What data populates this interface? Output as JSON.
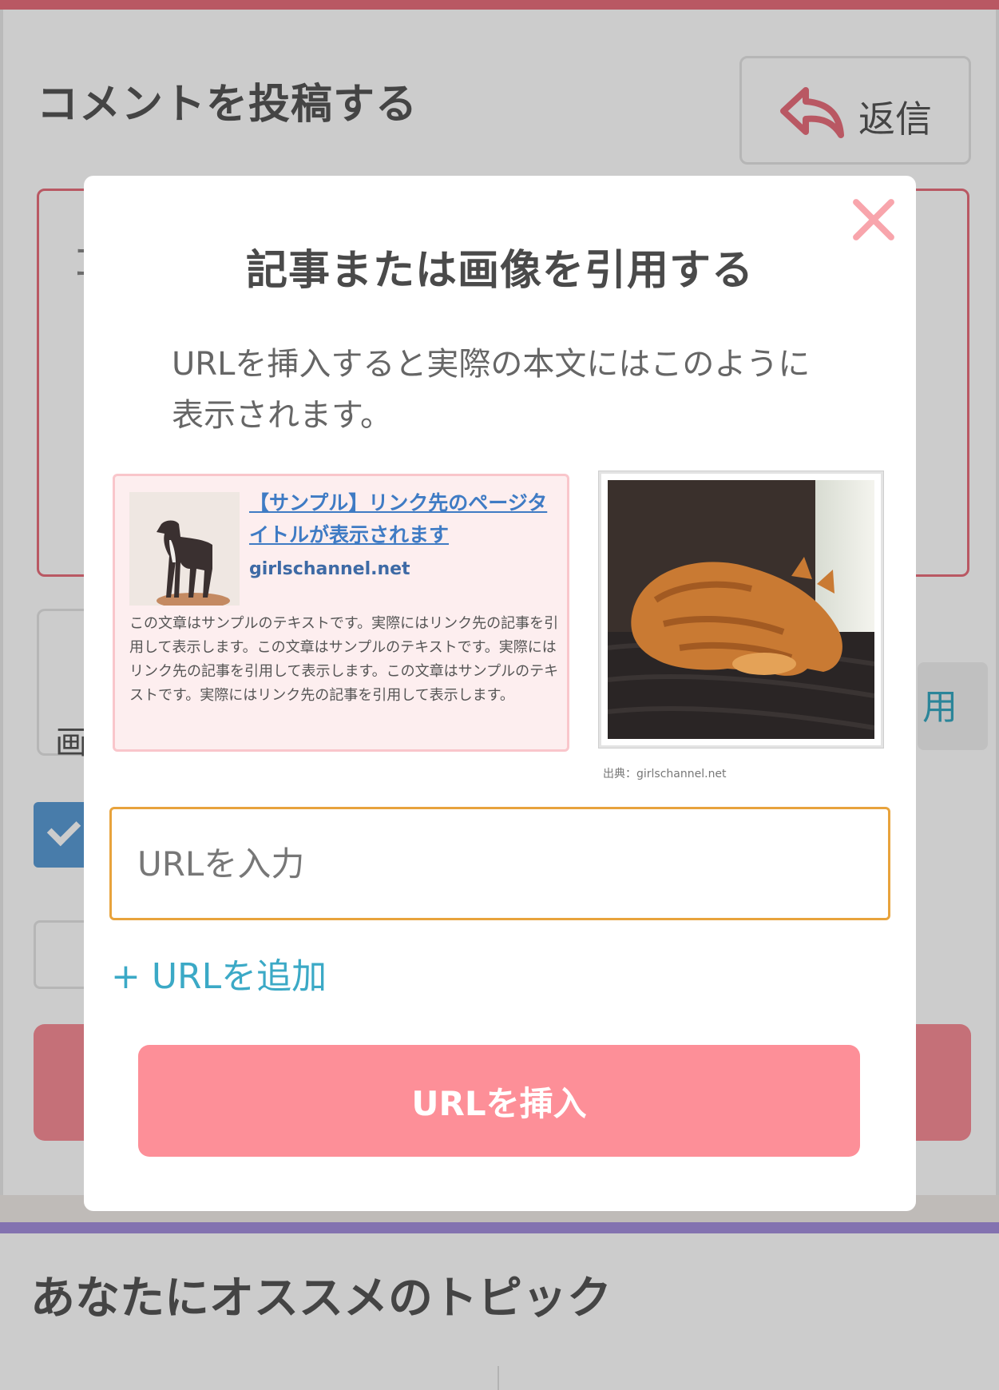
{
  "background": {
    "title": "コメントを投稿する",
    "reply_label": "返信",
    "textarea_char": "コ",
    "quote_chip_char": "用",
    "image_label": "画",
    "recommend_title": "あなたにオススメのトピック"
  },
  "modal": {
    "title": "記事または画像を引用する",
    "description": "URLを挿入すると実際の本文にはこのように表示されます。",
    "sample_link": {
      "title": "【サンプル】リンク先のページタイトルが表示されます",
      "domain": "girlschannel.net",
      "body": "この文章はサンプルのテキストです。実際にはリンク先の記事を引用して表示します。この文章はサンプルのテキストです。実際にはリンク先の記事を引用して表示します。この文章はサンプルのテキストです。実際にはリンク先の記事を引用して表示します。"
    },
    "sample_image_caption": "出典：girlschannel.net",
    "url_placeholder": "URLを入力",
    "add_url_label": "+ URLを追加",
    "insert_button_label": "URLを挿入"
  },
  "colors": {
    "accent_pink": "#fd8f98",
    "input_border": "#e8a33c",
    "link_blue": "#3ba9c6"
  },
  "icons": [
    "reply-icon",
    "close-icon",
    "checkmark-icon"
  ]
}
